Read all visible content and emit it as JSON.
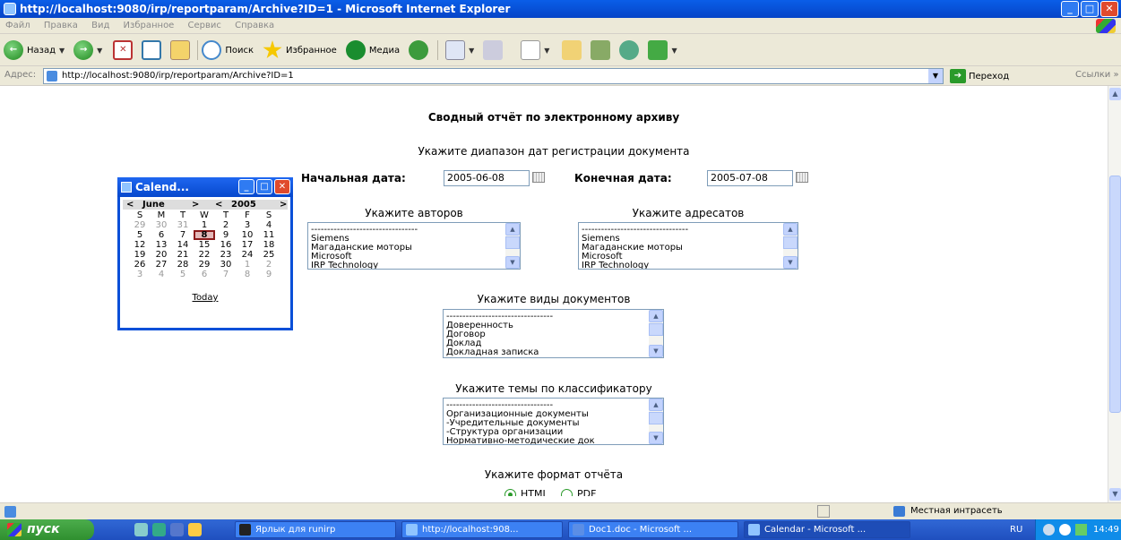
{
  "window": {
    "title": "http://localhost:9080/irp/reportparam/Archive?ID=1 - Microsoft Internet Explorer"
  },
  "menu": [
    "Файл",
    "Правка",
    "Вид",
    "Избранное",
    "Сервис",
    "Справка"
  ],
  "toolbar": {
    "back": "Назад",
    "search": "Поиск",
    "favorites": "Избранное",
    "media": "Медиа"
  },
  "address": {
    "label": "Адрес:",
    "url": "http://localhost:9080/irp/reportparam/Archive?ID=1",
    "go": "Переход",
    "links": "Ссылки"
  },
  "page": {
    "title": "Сводный отчёт по электронному архиву",
    "date_range_prompt": "Укажите диапазон дат регистрации документа",
    "start_label": "Начальная дата:",
    "start_value": "2005-06-08",
    "end_label": "Конечная дата:",
    "end_value": "2005-07-08",
    "authors_label": "Укажите авторов",
    "authors": [
      "---------------------------------",
      "Siemens",
      "Магаданские моторы",
      "Microsoft",
      "IRP Technology"
    ],
    "recipients_label": "Укажите адресатов",
    "recipients": [
      "---------------------------------",
      "Siemens",
      "Магаданские моторы",
      "Microsoft",
      "IRP Technology"
    ],
    "doctypes_label": "Укажите виды документов",
    "doctypes": [
      "---------------------------------",
      "Доверенность",
      "Договор",
      "Доклад",
      "Докладная записка"
    ],
    "topics_label": "Укажите темы по классификатору",
    "topics": [
      "---------------------------------",
      "Организационные документы",
      "-Учредительные документы",
      "-Структура организации",
      "Нормативно-методические док"
    ],
    "format_label": "Укажите формат отчёта",
    "format_options": [
      "HTML",
      "PDF"
    ],
    "format_selected": "HTML"
  },
  "calendar": {
    "title": "Calend...",
    "prev": "<",
    "next": ">",
    "month": "June",
    "year": "2005",
    "weekdays": [
      "S",
      "M",
      "T",
      "W",
      "T",
      "F",
      "S"
    ],
    "weeks": [
      [
        "29",
        "30",
        "31",
        "1",
        "2",
        "3",
        "4"
      ],
      [
        "5",
        "6",
        "7",
        "8",
        "9",
        "10",
        "11"
      ],
      [
        "12",
        "13",
        "14",
        "15",
        "16",
        "17",
        "18"
      ],
      [
        "19",
        "20",
        "21",
        "22",
        "23",
        "24",
        "25"
      ],
      [
        "26",
        "27",
        "28",
        "29",
        "30",
        "1",
        "2"
      ],
      [
        "3",
        "4",
        "5",
        "6",
        "7",
        "8",
        "9"
      ]
    ],
    "selected": "8",
    "today": "Today"
  },
  "status": {
    "zone": "Местная интрасеть"
  },
  "taskbar": {
    "start": "пуск",
    "tasks": [
      "Ярлык для runirp",
      "http://localhost:908...",
      "Doc1.doc - Microsoft ...",
      "Calendar - Microsoft ..."
    ],
    "lang": "RU",
    "clock": "14:49"
  }
}
